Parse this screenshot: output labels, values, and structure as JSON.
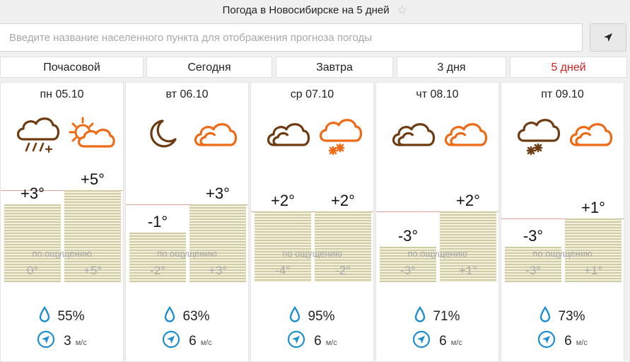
{
  "header": {
    "title": "Погода в Новосибирске на 5 дней",
    "star_icon": "star-icon"
  },
  "search": {
    "placeholder": "Введите название населенного пункта для отображения прогноза погоды",
    "value": ""
  },
  "tabs": [
    {
      "label": "Почасовой",
      "active": false
    },
    {
      "label": "Сегодня",
      "active": false
    },
    {
      "label": "Завтра",
      "active": false
    },
    {
      "label": "3 дня",
      "active": false
    },
    {
      "label": "5 дней",
      "active": true
    }
  ],
  "colors": {
    "icon_brown": "#6e3c12",
    "icon_orange": "#ee6a14",
    "accent_red": "#d32020",
    "bar_stripe": "#cfcca4",
    "water_blue": "#1e8fd0"
  },
  "feels_like_label": "по ощущению",
  "days": [
    {
      "date": "пн 05.10",
      "night_icon": "cloud-rain-snow-icon",
      "day_icon": "sun-cloud-icon",
      "night_temp": "+3°",
      "day_temp": "+5°",
      "night_feels": "0°",
      "day_feels": "+5°",
      "humidity": "55%",
      "wind_speed": "3",
      "wind_unit": "м/с"
    },
    {
      "date": "вт 06.10",
      "night_icon": "moon-icon",
      "day_icon": "cloud-icon",
      "night_temp": "-1°",
      "day_temp": "+3°",
      "night_feels": "-2°",
      "day_feels": "+3°",
      "humidity": "63%",
      "wind_speed": "6",
      "wind_unit": "м/с"
    },
    {
      "date": "ср 07.10",
      "night_icon": "cloud-icon",
      "day_icon": "cloud-snow-icon",
      "night_temp": "+2°",
      "day_temp": "+2°",
      "night_feels": "-4°",
      "day_feels": "-2°",
      "humidity": "95%",
      "wind_speed": "6",
      "wind_unit": "м/с"
    },
    {
      "date": "чт 08.10",
      "night_icon": "cloud-icon",
      "day_icon": "cloud-icon",
      "night_temp": "-3°",
      "day_temp": "+2°",
      "night_feels": "-3°",
      "day_feels": "+1°",
      "humidity": "71%",
      "wind_speed": "6",
      "wind_unit": "м/с"
    },
    {
      "date": "пт 09.10",
      "night_icon": "cloud-snow-icon",
      "day_icon": "cloud-icon",
      "night_temp": "-3°",
      "day_temp": "+1°",
      "night_feels": "-3°",
      "day_feels": "+1°",
      "humidity": "73%",
      "wind_speed": "6",
      "wind_unit": "м/с"
    }
  ]
}
